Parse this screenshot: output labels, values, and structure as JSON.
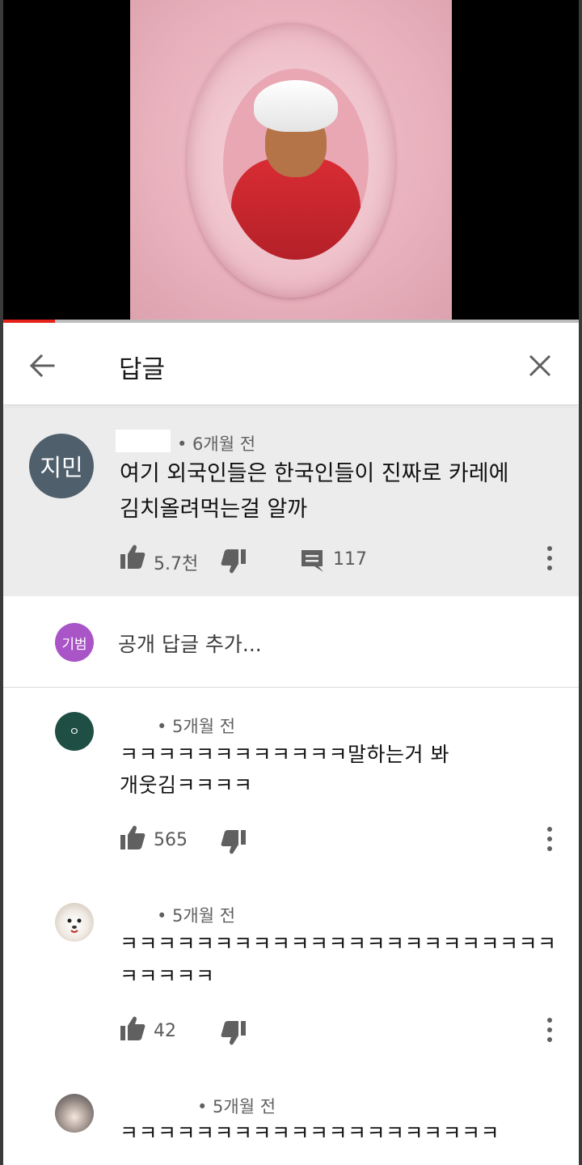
{
  "video": {
    "progress_fraction": 0.09
  },
  "header": {
    "title": "답글",
    "back_icon": "arrow-left-icon",
    "close_icon": "close-icon"
  },
  "top_comment": {
    "avatar_text": "지민",
    "time": "• 6개월 전",
    "text_line1": "여기 외국인들은 한국인들이 진짜로 카레에",
    "text_line2": "김치올려먹는걸 알까",
    "likes": "5.7천",
    "replies": "117"
  },
  "add_reply": {
    "avatar_text": "기범",
    "placeholder": "공개 답글 추가..."
  },
  "replies": [
    {
      "avatar_text": "ㅇ",
      "time": "• 5개월 전",
      "line1": "ㅋㅋㅋㅋㅋㅋㅋㅋㅋㅋㅋㅋ말하는거 봐",
      "line2": "개웃김ㅋㅋㅋㅋ",
      "likes": "565"
    },
    {
      "time": "• 5개월 전",
      "line1": "ㅋㅋㅋㅋㅋㅋㅋㅋㅋㅋㅋㅋㅋㅋㅋㅋㅋㅋㅋㅋㅋㅋㅋ",
      "line2": "ㅋㅋㅋㅋㅋ",
      "likes": "42"
    },
    {
      "time": "• 5개월 전",
      "line1": "ㅋㅋㅋㅋㅋㅋㅋㅋㅋㅋㅋㅋㅋㅋㅋㅋㅋㅋㅋㅋ"
    }
  ],
  "colors": {
    "accent_red": "#e62117",
    "top_avatar": "#4f5f6c",
    "user_avatar": "#a955c7",
    "reply_avatar_green": "#1f4f44"
  }
}
